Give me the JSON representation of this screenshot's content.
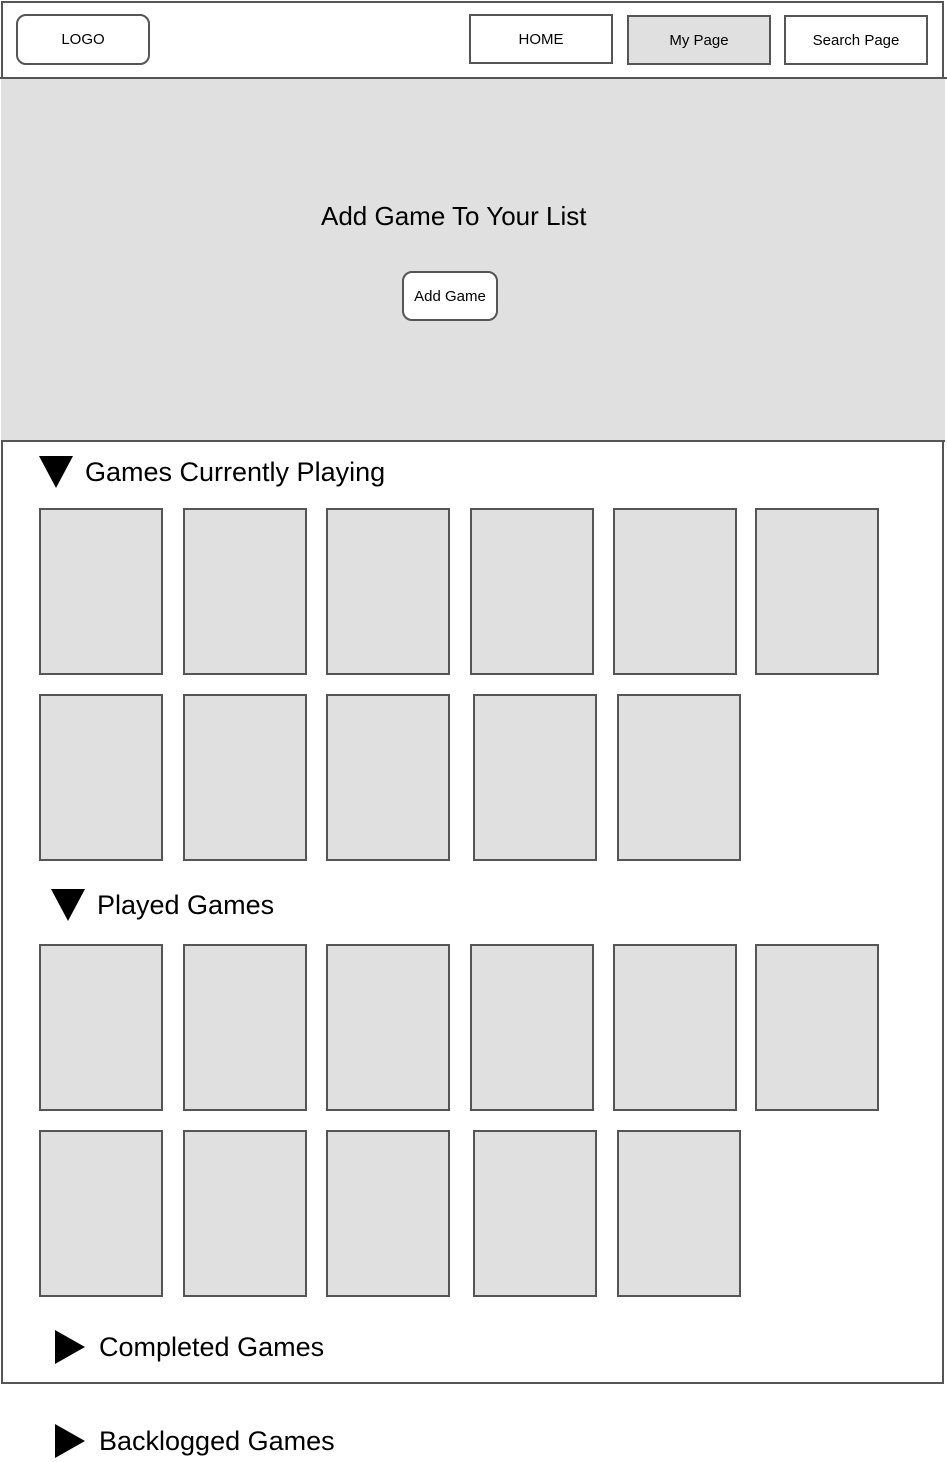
{
  "header": {
    "logo_label": "LOGO",
    "nav": {
      "home": "HOME",
      "my_page": "My Page",
      "search_page": "Search Page"
    }
  },
  "hero": {
    "title": "Add Game To Your List",
    "add_button": "Add Game"
  },
  "sections": {
    "currently_playing": {
      "title": "Games Currently Playing",
      "expanded": true,
      "card_count": 11
    },
    "played": {
      "title": "Played Games",
      "expanded": true,
      "card_count": 11
    },
    "completed": {
      "title": "Completed Games",
      "expanded": false
    },
    "backlogged": {
      "title": "Backlogged Games",
      "expanded": false
    }
  },
  "colors": {
    "border": "#555555",
    "placeholder_fill": "#e0e0e0",
    "active_nav_fill": "#e0e0e0"
  }
}
